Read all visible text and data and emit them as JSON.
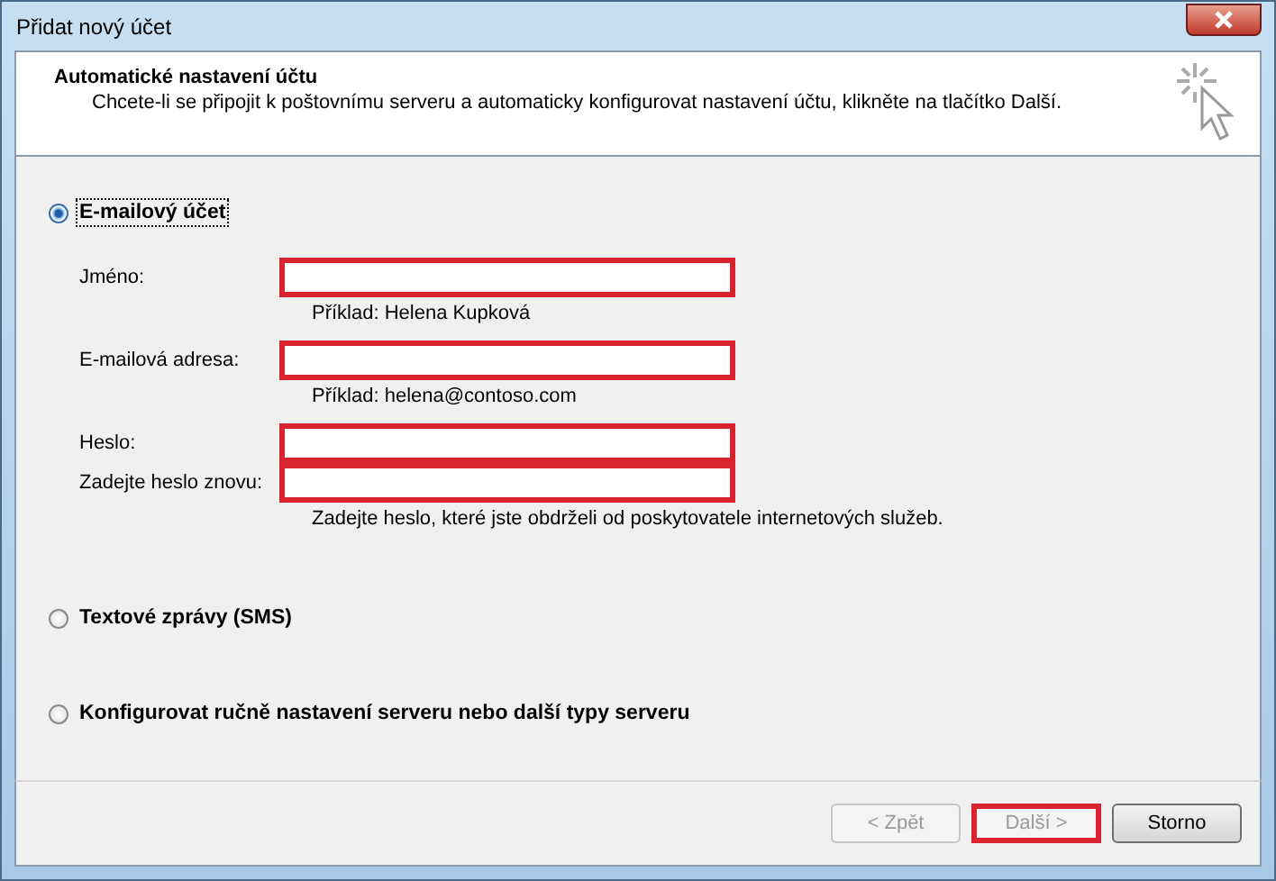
{
  "window": {
    "title": "Přidat nový účet"
  },
  "header": {
    "title": "Automatické nastavení účtu",
    "description": "Chcete-li se připojit k poštovnímu serveru a automaticky konfigurovat nastavení účtu, klikněte na tlačítko Další."
  },
  "options": [
    {
      "label": "E-mailový účet",
      "selected": true
    },
    {
      "label": "Textové zprávy (SMS)",
      "selected": false
    },
    {
      "label": "Konfigurovat ručně nastavení serveru nebo další typy serveru",
      "selected": false
    }
  ],
  "fields": [
    {
      "label": "Jméno:",
      "hint": "Příklad: Helena Kupková"
    },
    {
      "label": "E-mailová adresa:",
      "hint": "Příklad: helena@contoso.com"
    },
    {
      "label": "Heslo:"
    },
    {
      "label": "Zadejte heslo znovu:",
      "hint": "Zadejte heslo, které jste obdrželi od poskytovatele internetových služeb."
    }
  ],
  "buttons": [
    {
      "label": "< Zpět",
      "disabled": true,
      "highlighted": false
    },
    {
      "label": "Další >",
      "disabled": true,
      "highlighted": true
    },
    {
      "label": "Storno",
      "disabled": false,
      "highlighted": false
    }
  ]
}
